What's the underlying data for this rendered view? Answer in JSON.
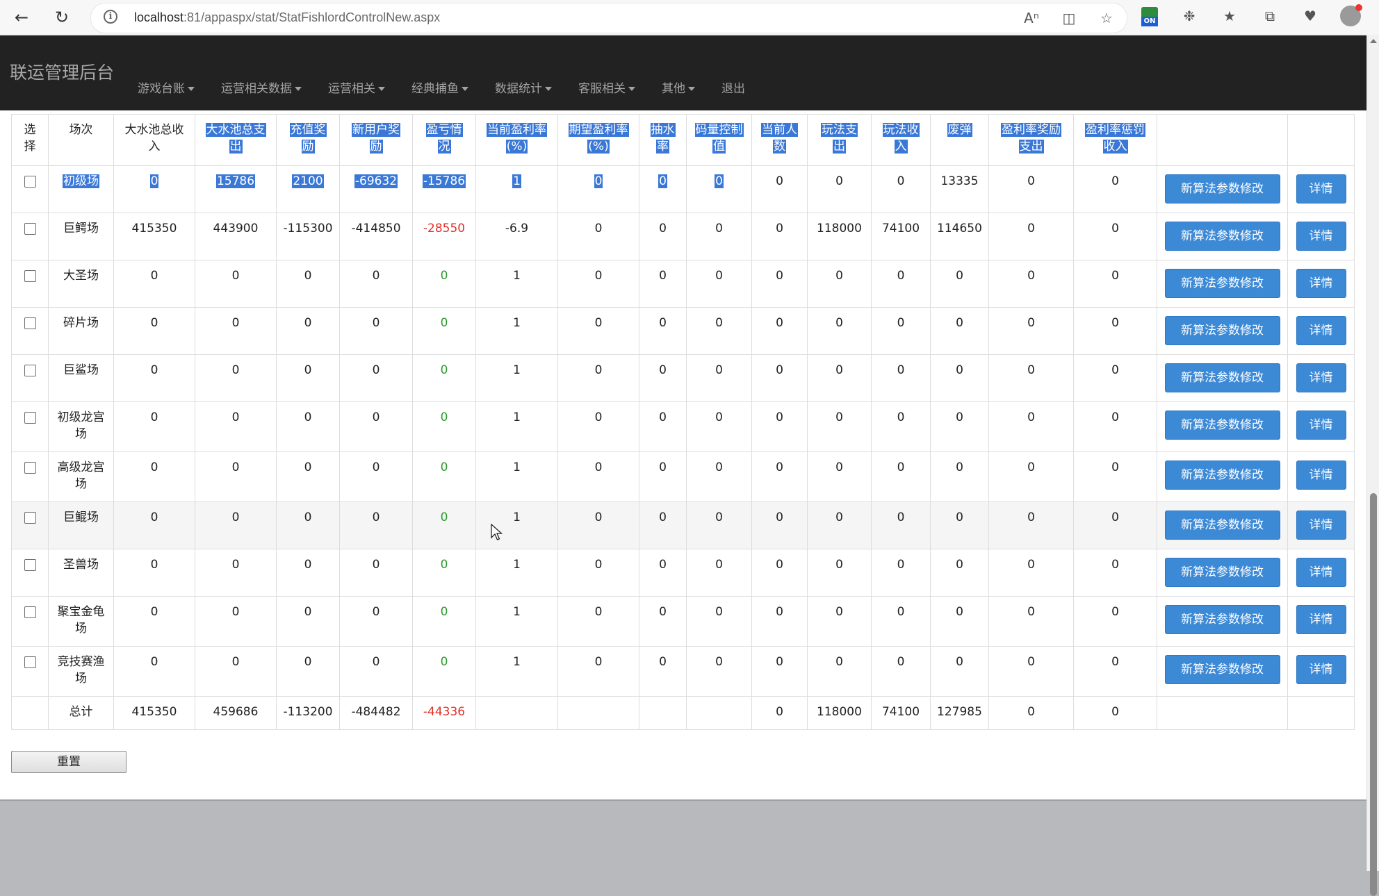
{
  "browser": {
    "url_host": "localhost",
    "url_rest": ":81/appaspx/stat/StatFishlordControlNew.aspx",
    "ext_badge": "ON"
  },
  "brand": "联运管理后台",
  "menu": [
    {
      "label": "游戏台账",
      "dropdown": true
    },
    {
      "label": "运营相关数据",
      "dropdown": true
    },
    {
      "label": "运营相关",
      "dropdown": true
    },
    {
      "label": "经典捕鱼",
      "dropdown": true
    },
    {
      "label": "数据统计",
      "dropdown": true
    },
    {
      "label": "客服相关",
      "dropdown": true
    },
    {
      "label": "其他",
      "dropdown": true
    },
    {
      "label": "退出",
      "dropdown": false
    }
  ],
  "table": {
    "headers": [
      {
        "text": "选\n择",
        "sel": false
      },
      {
        "text": "场次",
        "sel": false
      },
      {
        "text": "大水池总收\n入",
        "sel": false
      },
      {
        "text": "大水池总支\n出",
        "sel": true
      },
      {
        "text": "充值奖\n励",
        "sel": true
      },
      {
        "text": "新用户奖\n励",
        "sel": true
      },
      {
        "text": "盈亏情\n况",
        "sel": true
      },
      {
        "text": "当前盈利率\n(%)",
        "sel": true
      },
      {
        "text": "期望盈利率\n(%)",
        "sel": true
      },
      {
        "text": "抽水\n率",
        "sel": true
      },
      {
        "text": "码量控制\n值",
        "sel": true
      },
      {
        "text": "当前人\n数",
        "sel": true
      },
      {
        "text": "玩法支\n出",
        "sel": true
      },
      {
        "text": "玩法收\n入",
        "sel": true
      },
      {
        "text": "废弹",
        "sel": true
      },
      {
        "text": "盈利率奖励\n支出",
        "sel": true
      },
      {
        "text": "盈利率惩罚\n收入",
        "sel": true
      },
      {
        "text": "",
        "sel": false
      },
      {
        "text": "",
        "sel": false
      }
    ],
    "rows": [
      {
        "name": "初级场",
        "vals": [
          "0",
          "15786",
          "2100",
          "-69632",
          "-15786",
          "1",
          "0",
          "0",
          "0",
          "0",
          "0",
          "0",
          "13335",
          "0",
          "0"
        ],
        "sel_count": 10,
        "pl_color": "sel"
      },
      {
        "name": "巨鳄场",
        "vals": [
          "415350",
          "443900",
          "-115300",
          "-414850",
          "-28550",
          "-6.9",
          "0",
          "0",
          "0",
          "0",
          "118000",
          "74100",
          "114650",
          "0",
          "0"
        ],
        "sel_count": 0,
        "pl_color": "red"
      },
      {
        "name": "大圣场",
        "vals": [
          "0",
          "0",
          "0",
          "0",
          "0",
          "1",
          "0",
          "0",
          "0",
          "0",
          "0",
          "0",
          "0",
          "0",
          "0"
        ],
        "sel_count": 0,
        "pl_color": "green"
      },
      {
        "name": "碎片场",
        "vals": [
          "0",
          "0",
          "0",
          "0",
          "0",
          "1",
          "0",
          "0",
          "0",
          "0",
          "0",
          "0",
          "0",
          "0",
          "0"
        ],
        "sel_count": 0,
        "pl_color": "green"
      },
      {
        "name": "巨鲨场",
        "vals": [
          "0",
          "0",
          "0",
          "0",
          "0",
          "1",
          "0",
          "0",
          "0",
          "0",
          "0",
          "0",
          "0",
          "0",
          "0"
        ],
        "sel_count": 0,
        "pl_color": "green"
      },
      {
        "name": "初级龙宫\n场",
        "vals": [
          "0",
          "0",
          "0",
          "0",
          "0",
          "1",
          "0",
          "0",
          "0",
          "0",
          "0",
          "0",
          "0",
          "0",
          "0"
        ],
        "sel_count": 0,
        "pl_color": "green"
      },
      {
        "name": "高级龙宫\n场",
        "vals": [
          "0",
          "0",
          "0",
          "0",
          "0",
          "1",
          "0",
          "0",
          "0",
          "0",
          "0",
          "0",
          "0",
          "0",
          "0"
        ],
        "sel_count": 0,
        "pl_color": "green"
      },
      {
        "name": "巨鲲场",
        "vals": [
          "0",
          "0",
          "0",
          "0",
          "0",
          "1",
          "0",
          "0",
          "0",
          "0",
          "0",
          "0",
          "0",
          "0",
          "0"
        ],
        "sel_count": 0,
        "pl_color": "green",
        "hover": true
      },
      {
        "name": "圣兽场",
        "vals": [
          "0",
          "0",
          "0",
          "0",
          "0",
          "1",
          "0",
          "0",
          "0",
          "0",
          "0",
          "0",
          "0",
          "0",
          "0"
        ],
        "sel_count": 0,
        "pl_color": "green"
      },
      {
        "name": "聚宝金龟\n场",
        "vals": [
          "0",
          "0",
          "0",
          "0",
          "0",
          "1",
          "0",
          "0",
          "0",
          "0",
          "0",
          "0",
          "0",
          "0",
          "0"
        ],
        "sel_count": 0,
        "pl_color": "green"
      },
      {
        "name": "竞技赛渔\n场",
        "vals": [
          "0",
          "0",
          "0",
          "0",
          "0",
          "1",
          "0",
          "0",
          "0",
          "0",
          "0",
          "0",
          "0",
          "0",
          "0"
        ],
        "sel_count": 0,
        "pl_color": "green"
      }
    ],
    "total": {
      "name": "总计",
      "vals": [
        "415350",
        "459686",
        "-113200",
        "-484482",
        "-44336",
        "",
        "",
        "",
        "",
        "0",
        "118000",
        "74100",
        "127985",
        "0",
        "0"
      ]
    },
    "edit_label": "新算法参数修改",
    "detail_label": "详情"
  },
  "reset_label": "重置"
}
